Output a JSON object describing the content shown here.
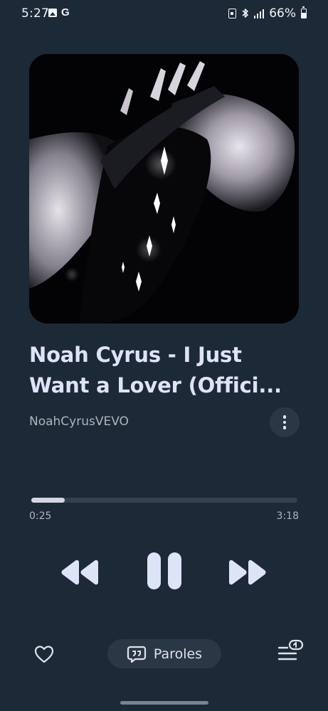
{
  "status_bar": {
    "time": "5:27",
    "battery": "66%",
    "icons": [
      "gallery-icon",
      "google-icon",
      "sim-icon",
      "bluetooth-icon",
      "signal-icon",
      "battery-icon"
    ]
  },
  "track": {
    "title": "Noah Cyrus - I Just Want a Lover (Offici...",
    "artist": "NoahCyrusVEVO"
  },
  "playback": {
    "elapsed": "0:25",
    "duration": "3:18",
    "progress": 0.126,
    "state": "playing"
  },
  "bottom_bar": {
    "lyrics_label": "Paroles"
  },
  "colors": {
    "background": "#1c2937",
    "control": "#dde4f8",
    "chip": "#2a3745"
  }
}
